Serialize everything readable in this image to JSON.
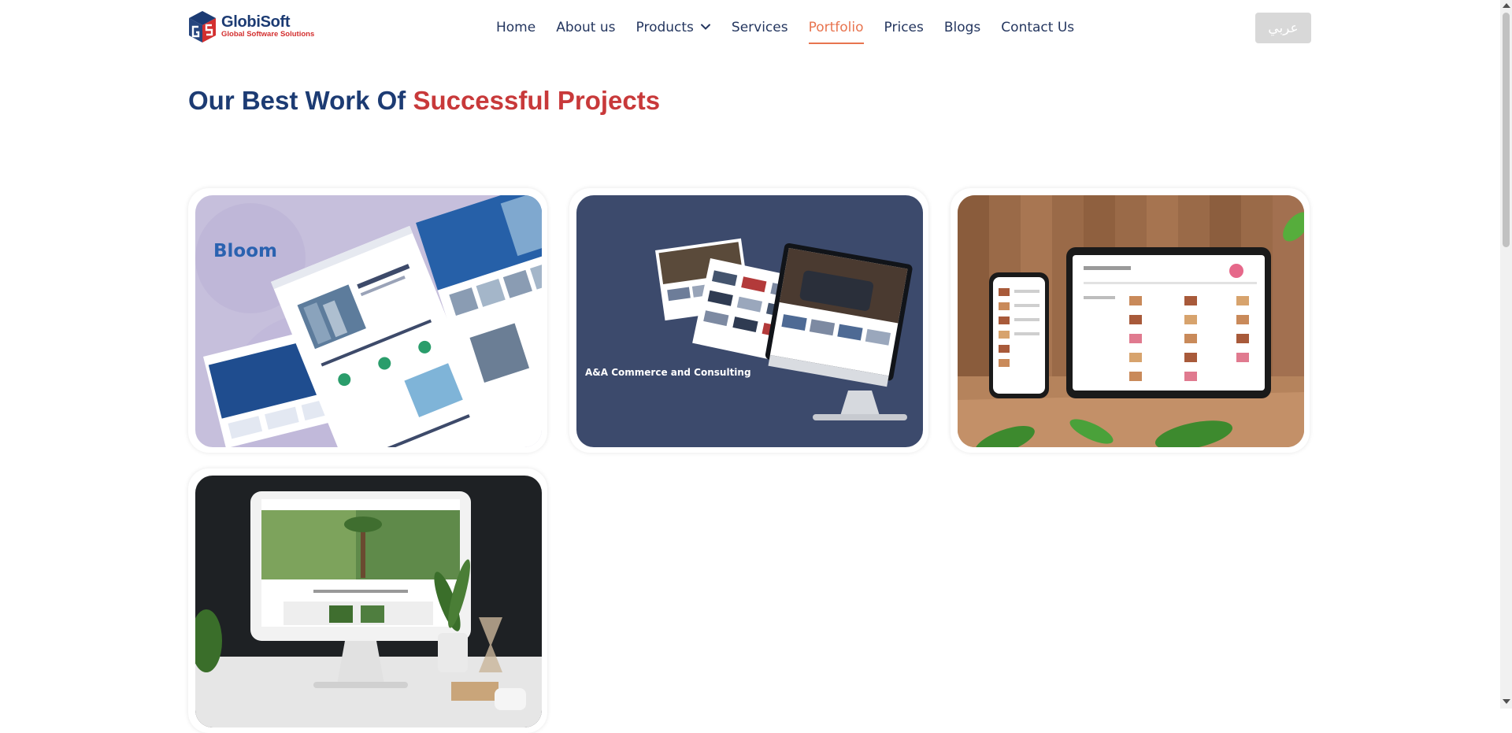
{
  "brand": {
    "name": "GlobiSoft",
    "tagline": "Global Software Solutions",
    "colors": {
      "navy": "#1c3b73",
      "red": "#c8393a",
      "accent": "#e8744f"
    }
  },
  "nav": {
    "items": [
      {
        "label": "Home"
      },
      {
        "label": "About us"
      },
      {
        "label": "Products",
        "has_dropdown": true
      },
      {
        "label": "Services"
      },
      {
        "label": "Portfolio",
        "active": true
      },
      {
        "label": "Prices"
      },
      {
        "label": "Blogs"
      },
      {
        "label": "Contact Us"
      }
    ],
    "language_button": "عربي"
  },
  "page": {
    "heading_part1": "Our Best Work Of",
    "heading_part2": "Successful Projects"
  },
  "portfolio": {
    "items": [
      {
        "image": "real-estate-website-mockup",
        "label": "Bloom"
      },
      {
        "image": "car-dealer-website-mockup",
        "label": "A&A Commerce and Consulting"
      },
      {
        "image": "food-menu-app-mockup"
      },
      {
        "image": "desktop-monitor-website-mockup"
      }
    ]
  }
}
